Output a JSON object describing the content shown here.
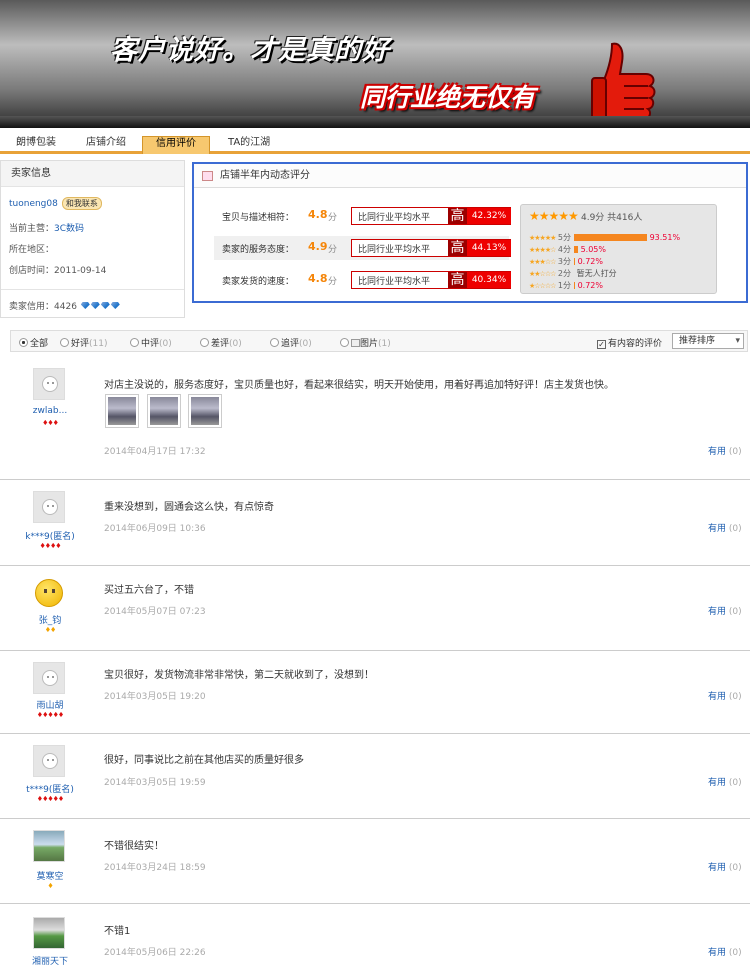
{
  "banner": {
    "slogan": "客户说好。才是真的好",
    "slogan2": "同行业绝无仅有"
  },
  "nav": {
    "tabs": [
      "朗博包装",
      "店铺介绍",
      "信用评价",
      "TA的江湖"
    ],
    "active": "信用评价"
  },
  "seller": {
    "title": "卖家信息",
    "name": "tuoneng08",
    "contact": "和我联系",
    "main_label": "当前主营：",
    "main_value": "3C数码",
    "region_label": "所在地区：",
    "region_value": "",
    "created_label": "创店时间：",
    "created_value": "2011-09-14",
    "credit_label": "卖家信用：",
    "credit_value": "4426"
  },
  "rating": {
    "title": "店铺半年内动态评分",
    "dims": [
      {
        "label": "宝贝与描述相符：",
        "score": "4.8",
        "unit": "分",
        "compare": "比同行业平均水平",
        "level": "高",
        "pct": "42.32%"
      },
      {
        "label": "卖家的服务态度：",
        "score": "4.9",
        "unit": "分",
        "compare": "比同行业平均水平",
        "level": "高",
        "pct": "44.13%"
      },
      {
        "label": "卖家发货的速度：",
        "score": "4.8",
        "unit": "分",
        "compare": "比同行业平均水平",
        "level": "高",
        "pct": "40.34%"
      }
    ],
    "summary": "4.9分 共416人",
    "distribution": [
      {
        "label": "5分",
        "pct": "93.51%",
        "value": 93.51
      },
      {
        "label": "4分",
        "pct": "5.05%",
        "value": 5.05
      },
      {
        "label": "3分",
        "pct": "0.72%",
        "value": 0.72
      },
      {
        "label": "2分",
        "pct": "暂无人打分",
        "value": 0
      },
      {
        "label": "1分",
        "pct": "0.72%",
        "value": 0.72
      }
    ]
  },
  "filter": {
    "options": [
      {
        "label": "全部",
        "count": ""
      },
      {
        "label": "好评",
        "count": "(11)"
      },
      {
        "label": "中评",
        "count": "(0)"
      },
      {
        "label": "差评",
        "count": "(0)"
      },
      {
        "label": "追评",
        "count": "(0)"
      },
      {
        "label": "图片",
        "count": "(1)"
      }
    ],
    "has_content": "有内容的评价",
    "sort": "推荐排序"
  },
  "reviews": [
    {
      "user": "zwlab...",
      "text": "对店主没说的，服务态度好，宝贝质量也好，看起来很结实，明天开始使用，用着好再追加特好评！店主发货也快。",
      "date": "2014年04月17日 17:32",
      "useful": "有用",
      "useful_count": "(0)",
      "hearts": "♦♦♦"
    },
    {
      "user": "k***9(匿名)",
      "text": "重来没想到，圆通会这么快，有点惊奇",
      "date": "2014年06月09日 10:36",
      "useful": "有用",
      "useful_count": "(0)",
      "hearts": "♦♦♦♦"
    },
    {
      "user": "张_钧",
      "text": "买过五六台了，不错",
      "date": "2014年05月07日 07:23",
      "useful": "有用",
      "useful_count": "(0)",
      "hearts": "♦♦"
    },
    {
      "user": "雨山胡",
      "text": "宝贝很好，发货物流非常非常快，第二天就收到了，没想到！",
      "date": "2014年03月05日 19:20",
      "useful": "有用",
      "useful_count": "(0)",
      "hearts": "♦♦♦♦♦"
    },
    {
      "user": "t***9(匿名)",
      "text": "很好，同事说比之前在其他店买的质量好很多",
      "date": "2014年03月05日 19:59",
      "useful": "有用",
      "useful_count": "(0)",
      "hearts": "♦♦♦♦♦"
    },
    {
      "user": "莫寒空",
      "text": "不错很结实！",
      "date": "2014年03月24日 18:59",
      "useful": "有用",
      "useful_count": "(0)",
      "hearts": "♦"
    },
    {
      "user": "湘丽天下",
      "text": "不错1",
      "date": "2014年05月06日 22:26",
      "useful": "有用",
      "useful_count": "(0)",
      "hearts": ""
    }
  ]
}
